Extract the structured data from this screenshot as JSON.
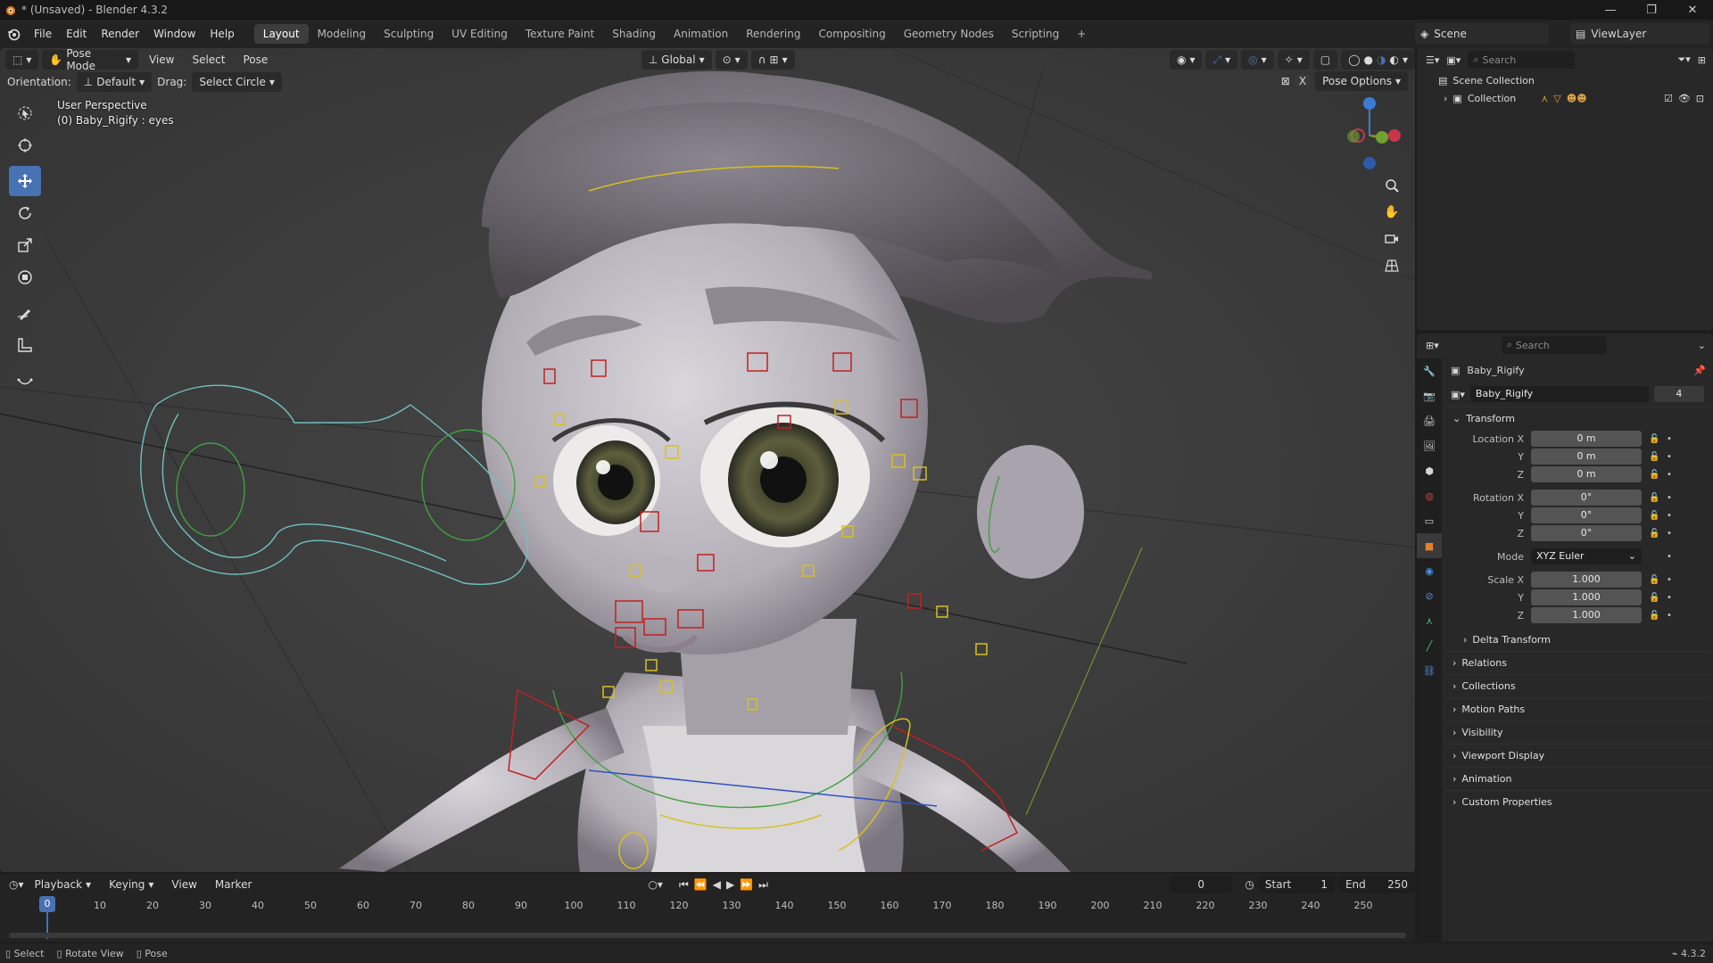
{
  "window": {
    "title": "* (Unsaved) - Blender 4.3.2"
  },
  "menus": [
    "File",
    "Edit",
    "Render",
    "Window",
    "Help"
  ],
  "workspaces": [
    {
      "label": "Layout",
      "active": true
    },
    {
      "label": "Modeling"
    },
    {
      "label": "Sculpting"
    },
    {
      "label": "UV Editing"
    },
    {
      "label": "Texture Paint"
    },
    {
      "label": "Shading"
    },
    {
      "label": "Animation"
    },
    {
      "label": "Rendering"
    },
    {
      "label": "Compositing"
    },
    {
      "label": "Geometry Nodes"
    },
    {
      "label": "Scripting"
    }
  ],
  "scene": {
    "name": "Scene"
  },
  "view_layer": {
    "name": "ViewLayer"
  },
  "viewport": {
    "mode": "Pose Mode",
    "menus": [
      "View",
      "Select",
      "Pose"
    ],
    "transform_orientation": "Global",
    "orientation_label": "Orientation:",
    "orientation_value": "Default",
    "drag_label": "Drag:",
    "drag_value": "Select Circle",
    "pose_options": "Pose Options",
    "info_line1": "User Perspective",
    "info_line2": "(0) Baby_Rigify : eyes",
    "gizmo_axes": {
      "x": "X",
      "y": "Y",
      "z": "Z"
    }
  },
  "outliner": {
    "search_placeholder": "Search",
    "root": "Scene Collection",
    "collection": "Collection"
  },
  "properties": {
    "search_placeholder": "Search",
    "object_name": "Baby_Rigify",
    "data_name": "Baby_Rigify",
    "users": "4",
    "transform": {
      "header": "Transform",
      "location_label": "Location X",
      "location": [
        "0 m",
        "0 m",
        "0 m"
      ],
      "rotation_label": "Rotation X",
      "rotation": [
        "0°",
        "0°",
        "0°"
      ],
      "mode_label": "Mode",
      "mode": "XYZ Euler",
      "scale_label": "Scale X",
      "scale": [
        "1.000",
        "1.000",
        "1.000"
      ],
      "y_label": "Y",
      "z_label": "Z"
    },
    "delta_transform": "Delta Transform",
    "panels": [
      "Relations",
      "Collections",
      "Motion Paths",
      "Visibility",
      "Viewport Display",
      "Animation",
      "Custom Properties"
    ]
  },
  "timeline": {
    "menus": [
      "Playback",
      "Keying",
      "View",
      "Marker"
    ],
    "current_frame": "0",
    "start_label": "Start",
    "start": "1",
    "end_label": "End",
    "end": "250",
    "ticks": [
      "10",
      "20",
      "30",
      "40",
      "50",
      "60",
      "70",
      "80",
      "90",
      "100",
      "110",
      "120",
      "130",
      "140",
      "150",
      "160",
      "170",
      "180",
      "190",
      "200",
      "210",
      "220",
      "230",
      "240",
      "250"
    ],
    "cursor_label": "0"
  },
  "statusbar": {
    "items": [
      "Select",
      "Rotate View",
      "Pose"
    ],
    "version": "4.3.2"
  },
  "colors": {
    "accent": "#4772b3",
    "active_tab": "#3d3d3d",
    "bone_yellow": "#d8c020",
    "bone_red": "#c02020",
    "bone_green": "#40a040",
    "bone_cyan": "#70c0c0"
  }
}
